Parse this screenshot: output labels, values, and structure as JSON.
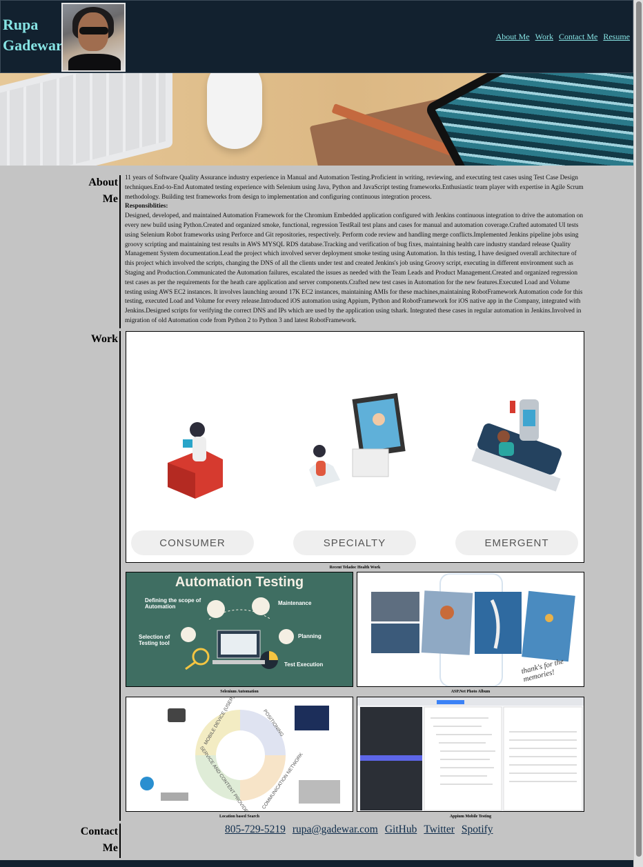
{
  "header": {
    "name_line1": "Rupa",
    "name_line2": "Gadewar",
    "nav": [
      "About Me",
      "Work",
      "Contact Me",
      "Resume"
    ]
  },
  "about": {
    "label_line1": "About",
    "label_line2": "Me",
    "intro": "11 years of Software Quality Assurance industry experience in Manual and Automation Testing.Proficient in writing, reviewing, and executing test cases using Test Case Design techniques.End-to-End Automated testing experience with Selenium using Java, Python and JavaScript testing frameworks.Enthusiastic team player with expertise in Agile Scrum methodology. Building test frameworks from design to implementation and configuring continuous integration process.",
    "resp_heading": "Responsiblities:",
    "responsibilities": "Designed, developed, and maintained Automation Framework for the Chromium Embedded application configured with Jenkins continuous integration to drive the automation on every new build using Python.Created and organized smoke, functional, regression TestRail test plans and cases for manual and automation coverage.Crafted automated UI tests using Selenium Robot frameworks using Perforce and Git repositories, respectively. Perform code review and handling merge conflicts.Implemented Jenkins pipeline jobs using groovy scripting and maintaining test results in AWS MYSQL RDS database.Tracking and verification of bug fixes, maintaining health care industry standard release Quality Management System documentation.Lead the project which involved server deployment smoke testing using Automation. In this testing, I have designed overall architecture of this project which involved the scripts, changing the DNS of all the clients under test and created Jenkins's job using Groovy script, executing in different environment such as Staging and Production.Communicated the Automation failures, escalated the issues as needed with the Team Leads and Product Management.Created and organized regression test cases as per the requirements for the heath care application and server components.Crafted new test cases in Automation for the new features.Executed Load and Volume testing using AWS EC2 instances. It involves launching around 17K EC2 instances, maintaining AMIs for these machines,maintaining RobotFramework Automation code for this testing, executed Load and Volume for every release.Introduced iOS automation using Appium, Python and RobotFramework for iOS native app in the Company, integrated with Jenkins.Designed scripts for verifying the correct DNS and IPs which are used by the application using tshark. Integrated these cases in regular automation in Jenkins.Involved in migration of old Automation code from Python 2 to Python 3 and latest RobotFramework."
  },
  "work": {
    "label": "Work",
    "teladoc": {
      "pills": [
        "CONSUMER",
        "SPECIALTY",
        "EMERGENT"
      ],
      "caption": "Recent Teladoc Health Work"
    },
    "automation": {
      "title": "Automation Testing",
      "items": [
        "Defining the scope of Automation",
        "Maintenance",
        "Selection of Testing tool",
        "Planning",
        "Test Execution"
      ],
      "caption": "Selenium Automation"
    },
    "album": {
      "script_text": "thank's for the memories!",
      "caption": "ASP.Net Photo Album"
    },
    "location": {
      "segments": [
        "MOBILE DEVICE (USER)",
        "POSITIONING",
        "COMMUNICATION NETWORK",
        "SERVICE AND CONTENT PROVIDER"
      ],
      "caption": "Location based Search"
    },
    "appium": {
      "caption": "Appium Mobile Testing"
    }
  },
  "contact": {
    "label_line1": "Contact",
    "label_line2": "Me",
    "links": [
      "805-729-5219",
      "rupa@gadewar.com",
      "GitHub",
      "Twitter",
      "Spotify"
    ]
  },
  "colors": {
    "header_bg": "#12212f",
    "accent": "#86e3e3",
    "page_bg": "#c4c4c4",
    "link": "#0d2b4a"
  }
}
